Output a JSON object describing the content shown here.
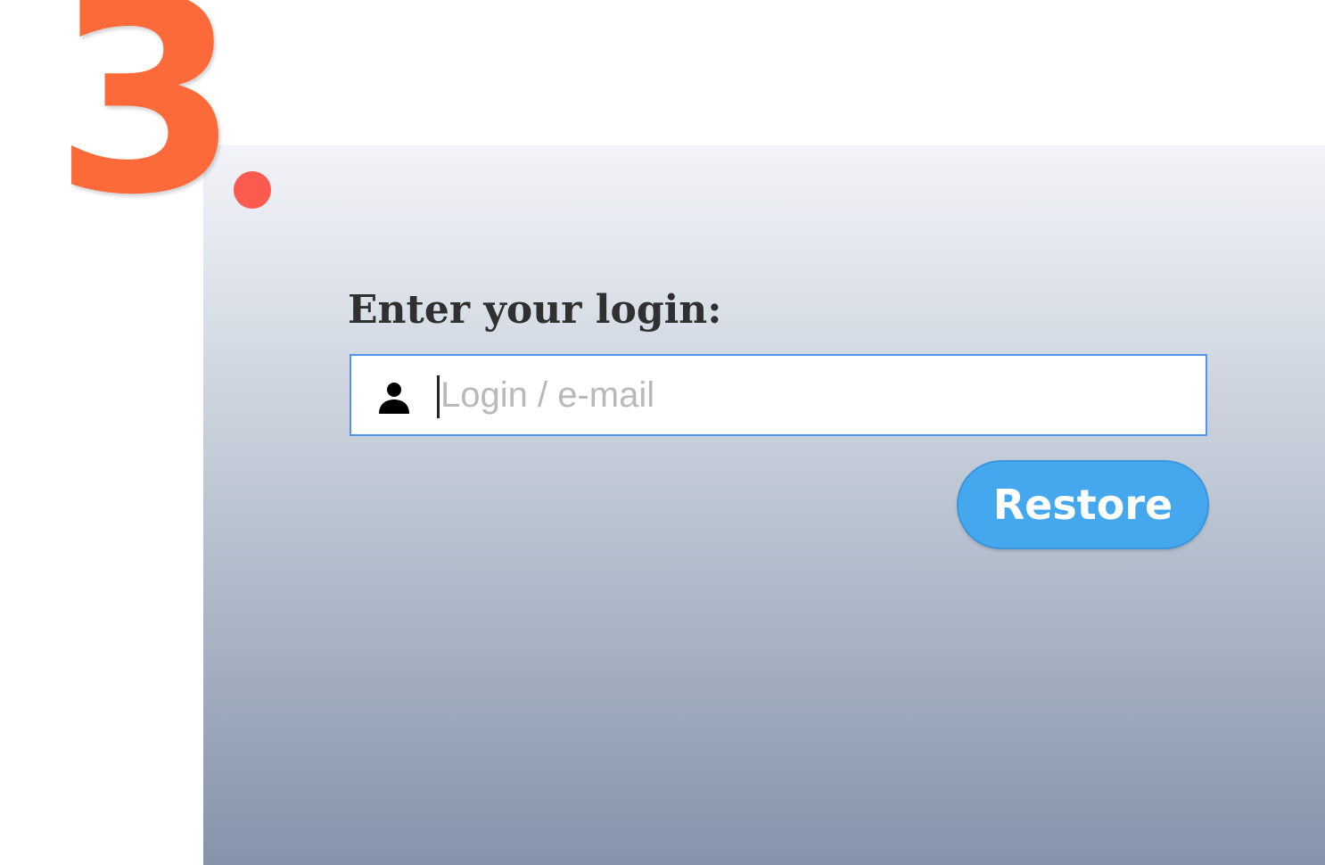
{
  "step": {
    "number": "3",
    "color": "#fc6a3a"
  },
  "indicator": {
    "color": "#fb5a4f"
  },
  "form": {
    "label": "Enter your login:",
    "input": {
      "value": "",
      "placeholder": "Login / e-mail",
      "icon": "user-icon",
      "border_color": "#4d96ec"
    },
    "restore_button": {
      "label": "Restore",
      "color": "#45a8ee"
    }
  }
}
